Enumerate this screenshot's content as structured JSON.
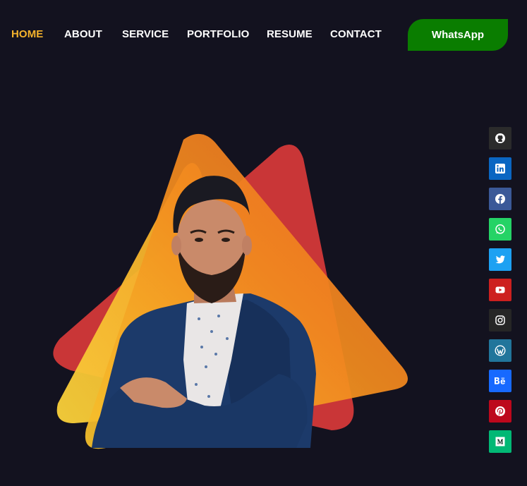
{
  "nav": {
    "items": [
      {
        "label": "HOME",
        "active": true
      },
      {
        "label": "ABOUT",
        "active": false
      },
      {
        "label": "SERVICE",
        "active": false
      },
      {
        "label": "PORTFOLIO",
        "active": false
      },
      {
        "label": "RESUME",
        "active": false
      },
      {
        "label": "CONTACT",
        "active": false
      }
    ],
    "cta_label": "WhatsApp"
  },
  "colors": {
    "background": "#13121f",
    "accent": "#f5b32c",
    "cta": "#0a7d00"
  },
  "social": [
    {
      "icon": "github-icon",
      "color": "#2b2b2b"
    },
    {
      "icon": "linkedin-icon",
      "color": "#0a66c2"
    },
    {
      "icon": "facebook-icon",
      "color": "#3b5998"
    },
    {
      "icon": "whatsapp-icon",
      "color": "#25d366"
    },
    {
      "icon": "twitter-icon",
      "color": "#1da1f2"
    },
    {
      "icon": "youtube-icon",
      "color": "#cd201f"
    },
    {
      "icon": "instagram-icon",
      "color": "#262626"
    },
    {
      "icon": "wordpress-icon",
      "color": "#21759b"
    },
    {
      "icon": "behance-icon",
      "color": "#1769ff"
    },
    {
      "icon": "pinterest-icon",
      "color": "#bd081c"
    },
    {
      "icon": "medium-icon",
      "color": "#02b875"
    }
  ]
}
